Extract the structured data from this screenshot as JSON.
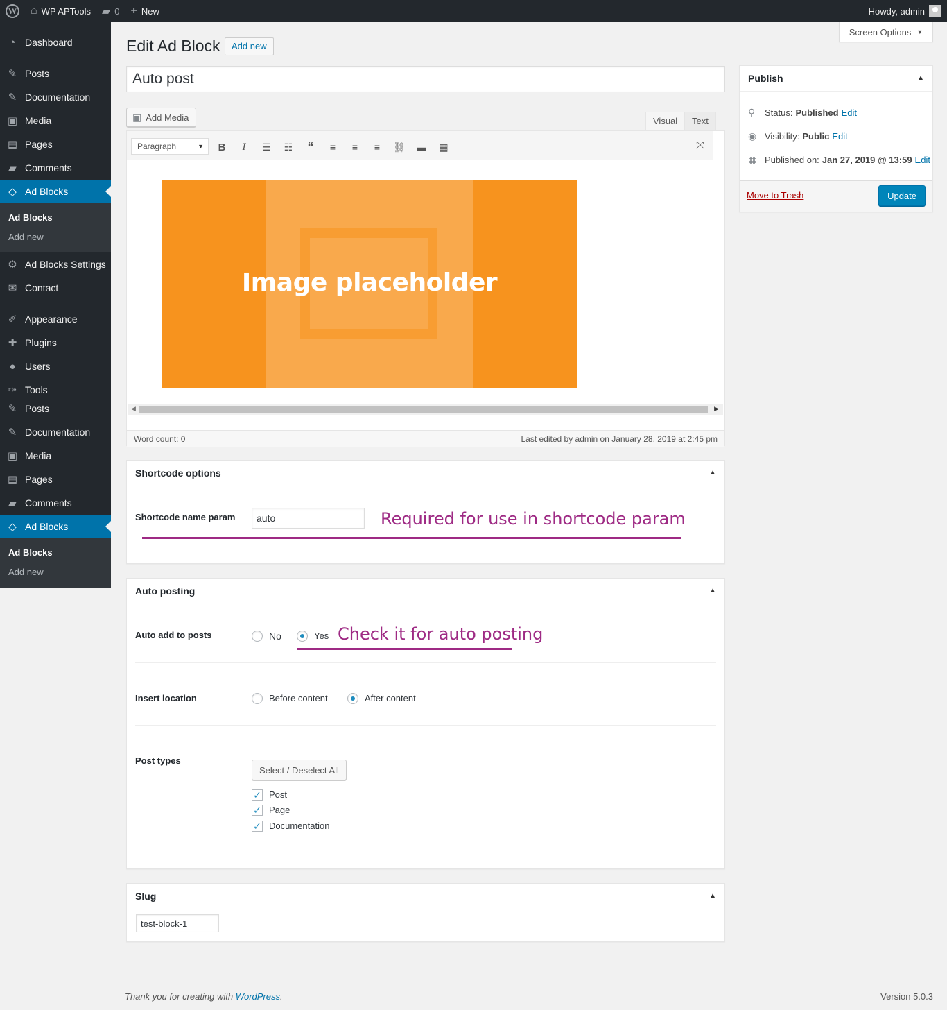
{
  "admin_bar": {
    "site_name": "WP APTools",
    "comments_count": "0",
    "new_label": "New",
    "howdy": "Howdy, admin"
  },
  "sidebar": {
    "items": [
      {
        "label": "Dashboard",
        "icon": "dashboard-icon"
      },
      {
        "label": "Posts",
        "icon": "pushpin-icon"
      },
      {
        "label": "Documentation",
        "icon": "pushpin-icon"
      },
      {
        "label": "Media",
        "icon": "media-icon"
      },
      {
        "label": "Pages",
        "icon": "pages-icon"
      },
      {
        "label": "Comments",
        "icon": "comments-icon"
      },
      {
        "label": "Ad Blocks",
        "icon": "code-icon"
      },
      {
        "label": "Ad Blocks Settings",
        "icon": "gear-icon"
      },
      {
        "label": "Contact",
        "icon": "envelope-icon"
      },
      {
        "label": "Appearance",
        "icon": "brush-icon"
      },
      {
        "label": "Plugins",
        "icon": "plugin-icon"
      },
      {
        "label": "Users",
        "icon": "user-icon"
      },
      {
        "label": "Tools",
        "icon": "wrench-icon"
      },
      {
        "label": "Posts",
        "icon": "pushpin-icon"
      },
      {
        "label": "Documentation",
        "icon": "pushpin-icon"
      },
      {
        "label": "Media",
        "icon": "media-icon"
      },
      {
        "label": "Pages",
        "icon": "pages-icon"
      },
      {
        "label": "Comments",
        "icon": "comments-icon"
      },
      {
        "label": "Ad Blocks",
        "icon": "code-icon"
      }
    ],
    "submenu": {
      "current": "Ad Blocks",
      "add_new": "Add new"
    }
  },
  "screen_options": "Screen Options",
  "page_title": "Edit Ad Block",
  "add_new_label": "Add new",
  "post_title": "Auto post",
  "editor": {
    "add_media": "Add Media",
    "tab_visual": "Visual",
    "tab_text": "Text",
    "format": "Paragraph",
    "image_label": "Image placeholder",
    "word_count": "Word count: 0",
    "last_edited": "Last edited by admin on January 28, 2019 at 2:45 pm"
  },
  "shortcode_box": {
    "title": "Shortcode options",
    "field_label": "Shortcode name param",
    "field_value": "auto",
    "annotation": "Required for use in shortcode param"
  },
  "autopost_box": {
    "title": "Auto posting",
    "auto_add_label": "Auto add to posts",
    "opt_no": "No",
    "opt_yes": "Yes",
    "annotation": "Check it for auto posting",
    "insert_label": "Insert location",
    "opt_before": "Before content",
    "opt_after": "After content",
    "post_types_label": "Post types",
    "select_all": "Select / Deselect All",
    "post_types": [
      "Post",
      "Page",
      "Documentation"
    ]
  },
  "slug_box": {
    "title": "Slug",
    "value": "test-block-1"
  },
  "publish_box": {
    "title": "Publish",
    "status_label": "Status:",
    "status_value": "Published",
    "visibility_label": "Visibility:",
    "visibility_value": "Public",
    "published_label": "Published on:",
    "published_value": "Jan 27, 2019 @ 13:59",
    "edit": "Edit",
    "trash": "Move to Trash",
    "update": "Update"
  },
  "footer": {
    "thanks_prefix": "Thank you for creating with",
    "wordpress_link": "WordPress",
    "period": ".",
    "version": "Version 5.0.3"
  },
  "colors": {
    "accent": "#0073aa",
    "annotation": "#9e2a84",
    "placeholder": "#f7931e"
  }
}
